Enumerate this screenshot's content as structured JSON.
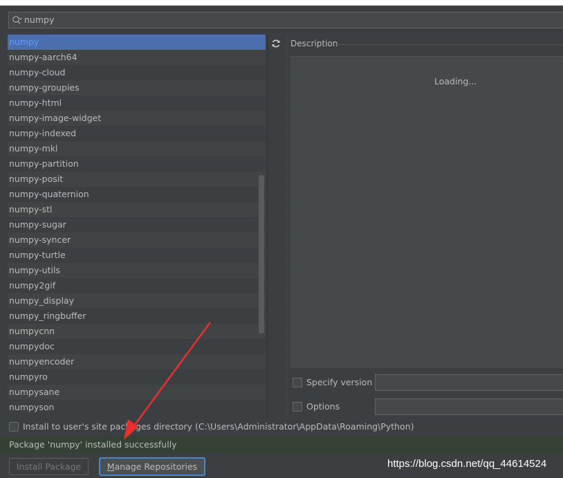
{
  "search": {
    "value": "numpy"
  },
  "packages": [
    "numpy",
    "numpy-aarch64",
    "numpy-cloud",
    "numpy-groupies",
    "numpy-html",
    "numpy-image-widget",
    "numpy-indexed",
    "numpy-mkl",
    "numpy-partition",
    "numpy-posit",
    "numpy-quaternion",
    "numpy-stl",
    "numpy-sugar",
    "numpy-syncer",
    "numpy-turtle",
    "numpy-utils",
    "numpy2gif",
    "numpy_display",
    "numpy_ringbuffer",
    "numpycnn",
    "numpydoc",
    "numpyencoder",
    "numpyro",
    "numpysane",
    "numpyson"
  ],
  "selected_index": 0,
  "description": {
    "header": "Description",
    "loading": "Loading..."
  },
  "options": {
    "specify_version_label": "Specify version",
    "options_label": "Options",
    "install_user_label": "Install to user's site packages directory (C:\\Users\\Administrator\\AppData\\Roaming\\Python)"
  },
  "status": {
    "message": "Package 'numpy' installed successfully"
  },
  "buttons": {
    "install_label": "Install Package",
    "manage_first": "M",
    "manage_rest": "anage Repositories"
  },
  "icons": {
    "search": "search-icon",
    "refresh": "refresh-icon"
  },
  "colors": {
    "selection": "#4b6eaf",
    "status_bg": "#344134",
    "arrow": "#e8312f"
  },
  "watermark": "https://blog.csdn.net/qq_44614524"
}
